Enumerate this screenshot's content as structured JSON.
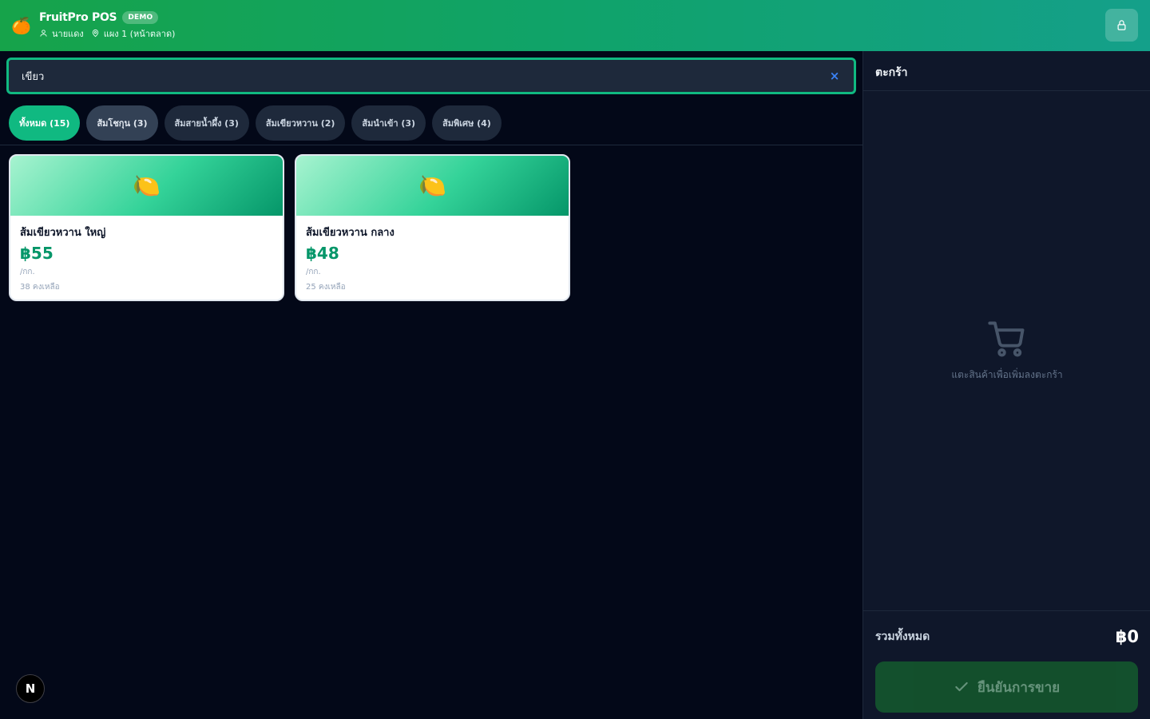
{
  "header": {
    "logo_icon": "🍊",
    "app_name": "FruitPro POS",
    "badge": "DEMO",
    "user": "นายแดง",
    "location": "แผง 1 (หน้าตลาด)",
    "lock_icon": "lock-icon"
  },
  "search": {
    "value": "เขียว",
    "placeholder": "",
    "clear_label": "×"
  },
  "tabs": [
    {
      "label": "ทั้งหมด (15)",
      "active": true
    },
    {
      "label": "ส้มโชกุน (3)",
      "active": false
    },
    {
      "label": "ส้มสายน้ำผึ้ง (3)",
      "active": false
    },
    {
      "label": "ส้มเขียวหวาน (2)",
      "active": false
    },
    {
      "label": "ส้มนำเข้า (3)",
      "active": false
    },
    {
      "label": "ส้มพิเศษ (4)",
      "active": false
    }
  ],
  "products": [
    {
      "icon": "🍋",
      "name": "ส้มเขียวหวาน ใหญ่",
      "price": "฿55",
      "unit": "/กก.",
      "stock": "38 คงเหลือ"
    },
    {
      "icon": "🍋",
      "name": "ส้มเขียวหวาน กลาง",
      "price": "฿48",
      "unit": "/กก.",
      "stock": "25 คงเหลือ"
    }
  ],
  "dev_badge": "N",
  "cart": {
    "title": "ตะกร้า",
    "empty_text": "แตะสินค้าเพื่อเพิ่มลงตะกร้า",
    "total_label": "รวมทั้งหมด",
    "total_value": "฿0",
    "confirm_label": "ยืนยันการขาย"
  },
  "colors": {
    "accent": "#10b981",
    "header_start": "#16a34a",
    "background": "#030818",
    "panel": "#0f172a"
  }
}
